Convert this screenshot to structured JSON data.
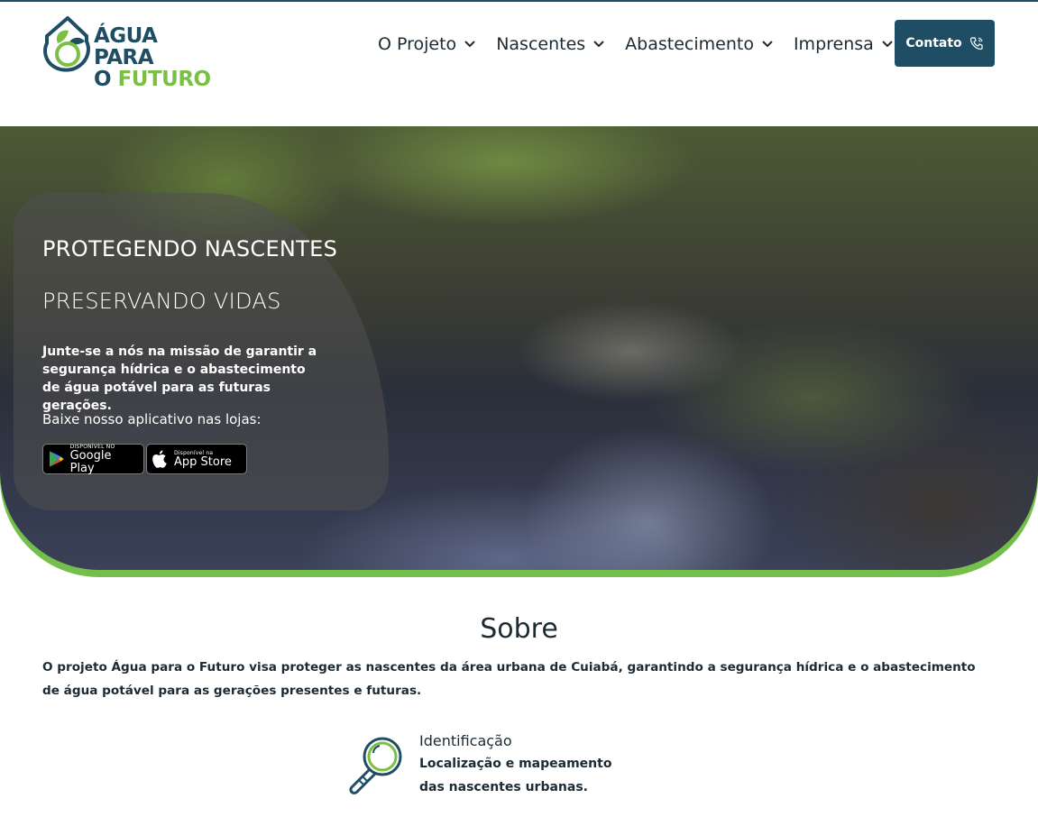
{
  "brand": {
    "line1": "ÁGUA PARA",
    "line2_a": "O ",
    "line2_b": "FUTURO",
    "colors": {
      "primary": "#1f4d63",
      "accent": "#7cbf45"
    }
  },
  "nav": {
    "items": [
      {
        "label": "O Projeto"
      },
      {
        "label": "Nascentes"
      },
      {
        "label": "Abastecimento"
      },
      {
        "label": "Imprensa"
      }
    ]
  },
  "header": {
    "contact_label": "Contato",
    "contact_icon": "phone-icon"
  },
  "hero": {
    "title1": "PROTEGENDO NASCENTES",
    "title2": "PRESERVANDO VIDAS",
    "text": "Junte-se a nós na missão de garantir a segurança hídrica e o abastecimento de água potável para as futuras gerações.",
    "apps_label": "Baixe nosso aplicativo nas lojas:",
    "google": {
      "small": "DISPONÍVEL NO",
      "big": "Google Play"
    },
    "apple": {
      "small": "Disponível na",
      "big": "App Store"
    }
  },
  "about": {
    "title": "Sobre",
    "text": "O projeto Água para o Futuro visa proteger as nascentes da área urbana de Cuiabá, garantindo a segurança hídrica e o abastecimento de água potável para as gerações presentes e futuras.",
    "feature": {
      "title": "Identificação",
      "desc": "Localização e mapeamento das nascentes urbanas.",
      "icon": "magnifier-icon"
    }
  }
}
